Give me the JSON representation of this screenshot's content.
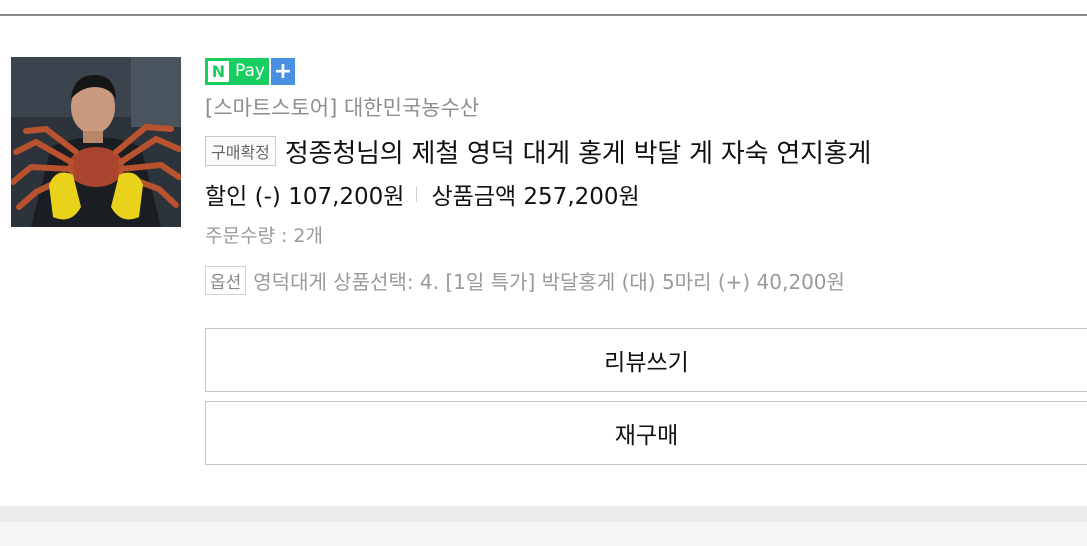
{
  "payment": {
    "logo_n": "N",
    "logo_text": "Pay",
    "plus_symbol": "+",
    "colors": {
      "npay_green": "#19ce60",
      "plus_blue": "#4a90e2"
    }
  },
  "order": {
    "store": "[스마트스토어] 대한민국농수산",
    "status_tag": "구매확정",
    "product_name": "정종청님의 제철 영덕 대게 홍게 박달 게 자숙 연지홍게",
    "discount": "할인 (-) 107,200원",
    "product_amount": "상품금액 257,200원",
    "quantity": "주문수량 : 2개",
    "option_tag": "옵션",
    "option_text": "영덕대게 상품선택: 4. [1일 특가] 박달홍게 (대) 5마리 (+) 40,200원",
    "thumbnail_icon": "product-photo-crab"
  },
  "actions": {
    "review_label": "리뷰쓰기",
    "rebuy_label": "재구매"
  }
}
